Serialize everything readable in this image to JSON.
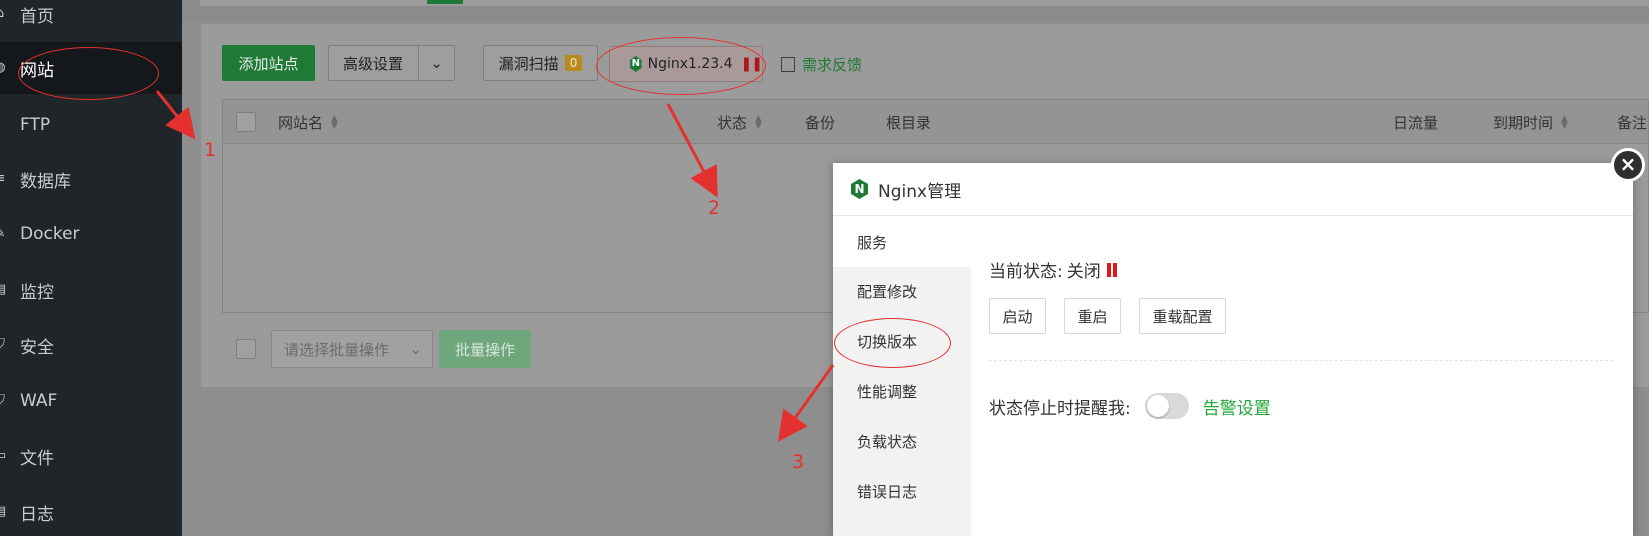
{
  "sidebar": {
    "items": [
      {
        "label": "首页",
        "icon": "home-icon"
      },
      {
        "label": "网站",
        "icon": "globe-icon",
        "active": true
      },
      {
        "label": "FTP",
        "icon": "ftp-icon"
      },
      {
        "label": "数据库",
        "icon": "database-icon"
      },
      {
        "label": "Docker",
        "icon": "docker-icon"
      },
      {
        "label": "监控",
        "icon": "monitor-icon"
      },
      {
        "label": "安全",
        "icon": "shield-icon"
      },
      {
        "label": "WAF",
        "icon": "waf-icon"
      },
      {
        "label": "文件",
        "icon": "folder-icon"
      },
      {
        "label": "日志",
        "icon": "log-icon"
      }
    ]
  },
  "toolbar": {
    "add_site": "添加站点",
    "advanced": "高级设置",
    "vuln_scan": "漏洞扫描",
    "vuln_count": "0",
    "nginx_label": "Nginx1.23.4",
    "feedback": "需求反馈"
  },
  "table": {
    "columns": [
      "网站名",
      "状态",
      "备份",
      "根目录",
      "日流量",
      "到期时间",
      "备注"
    ]
  },
  "batch": {
    "placeholder": "请选择批量操作",
    "button": "批量操作"
  },
  "modal": {
    "title": "Nginx管理",
    "nav": [
      "服务",
      "配置修改",
      "切换版本",
      "性能调整",
      "负载状态",
      "错误日志"
    ],
    "status_label": "当前状态:",
    "status_value": "关闭",
    "buttons": [
      "启动",
      "重启",
      "重载配置"
    ],
    "remind_label": "状态停止时提醒我:",
    "alarm_link": "告警设置"
  },
  "annotations": {
    "numbers": [
      "1",
      "2",
      "3"
    ],
    "color": "#e53030"
  },
  "colors": {
    "brand_green": "#20a53a",
    "sidebar_bg": "#20252a",
    "status_red": "#e0161b"
  }
}
